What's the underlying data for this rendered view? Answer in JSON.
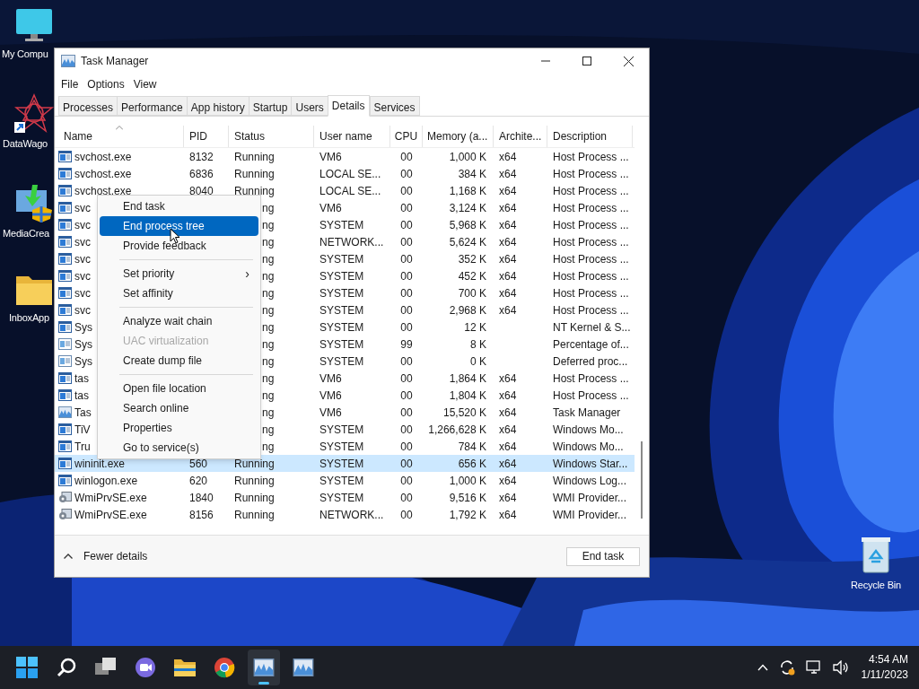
{
  "desktop_icons": [
    {
      "kind": "monitor",
      "label": "My Compu"
    },
    {
      "kind": "star",
      "label": "DataWago"
    },
    {
      "kind": "installer",
      "label": "MediaCrea"
    },
    {
      "kind": "folder",
      "label": "InboxApp"
    },
    {
      "kind": "bin",
      "label": "Recycle Bin"
    }
  ],
  "window": {
    "title": "Task Manager"
  },
  "menu_bar": [
    "File",
    "Options",
    "View"
  ],
  "tabs": [
    {
      "label": "Processes",
      "selected": false
    },
    {
      "label": "Performance",
      "selected": false
    },
    {
      "label": "App history",
      "selected": false
    },
    {
      "label": "Startup",
      "selected": false
    },
    {
      "label": "Users",
      "selected": false
    },
    {
      "label": "Details",
      "selected": true
    },
    {
      "label": "Services",
      "selected": false
    }
  ],
  "table": {
    "columns": [
      "Name",
      "PID",
      "Status",
      "User name",
      "CPU",
      "Memory (a...",
      "Archite...",
      "Description"
    ],
    "rows": [
      {
        "kind": "app",
        "name": "svchost.exe",
        "pid": "8132",
        "status": "Running",
        "user": "VM6",
        "cpu": "00",
        "memory": "1,000 K",
        "arch": "x64",
        "description": "Host Process ...",
        "selected": false
      },
      {
        "kind": "app",
        "name": "svchost.exe",
        "pid": "6836",
        "status": "Running",
        "user": "LOCAL SE...",
        "cpu": "00",
        "memory": "384 K",
        "arch": "x64",
        "description": "Host Process ...",
        "selected": false
      },
      {
        "kind": "app",
        "name": "svchost.exe",
        "pid": "8040",
        "status": "Running",
        "user": "LOCAL SE...",
        "cpu": "00",
        "memory": "1,168 K",
        "arch": "x64",
        "description": "Host Process ...",
        "selected": false
      },
      {
        "kind": "app",
        "name": "svc",
        "status": "ng",
        "user": "VM6",
        "cpu": "00",
        "memory": "3,124 K",
        "arch": "x64",
        "description": "Host Process ...",
        "selected": false
      },
      {
        "kind": "app",
        "name": "svc",
        "status": "ng",
        "user": "SYSTEM",
        "cpu": "00",
        "memory": "5,968 K",
        "arch": "x64",
        "description": "Host Process ...",
        "selected": false
      },
      {
        "kind": "app",
        "name": "svc",
        "status": "ng",
        "user": "NETWORK...",
        "cpu": "00",
        "memory": "5,624 K",
        "arch": "x64",
        "description": "Host Process ...",
        "selected": false
      },
      {
        "kind": "app",
        "name": "svc",
        "status": "ng",
        "user": "SYSTEM",
        "cpu": "00",
        "memory": "352 K",
        "arch": "x64",
        "description": "Host Process ...",
        "selected": false
      },
      {
        "kind": "app",
        "name": "svc",
        "status": "ng",
        "user": "SYSTEM",
        "cpu": "00",
        "memory": "452 K",
        "arch": "x64",
        "description": "Host Process ...",
        "selected": false
      },
      {
        "kind": "app",
        "name": "svc",
        "status": "ng",
        "user": "SYSTEM",
        "cpu": "00",
        "memory": "700 K",
        "arch": "x64",
        "description": "Host Process ...",
        "selected": false
      },
      {
        "kind": "app",
        "name": "svc",
        "status": "ng",
        "user": "SYSTEM",
        "cpu": "00",
        "memory": "2,968 K",
        "arch": "x64",
        "description": "Host Process ...",
        "selected": false
      },
      {
        "kind": "app",
        "name": "Sys",
        "status": "ng",
        "user": "SYSTEM",
        "cpu": "00",
        "memory": "12 K",
        "description": "NT Kernel & S...",
        "selected": false
      },
      {
        "kind": "system",
        "name": "Sys",
        "status": "ng",
        "user": "SYSTEM",
        "cpu": "99",
        "memory": "8 K",
        "description": "Percentage of...",
        "selected": false
      },
      {
        "kind": "system",
        "name": "Sys",
        "status": "ng",
        "user": "SYSTEM",
        "cpu": "00",
        "memory": "0 K",
        "description": "Deferred proc...",
        "selected": false
      },
      {
        "kind": "app",
        "name": "tas",
        "status": "ng",
        "user": "VM6",
        "cpu": "00",
        "memory": "1,864 K",
        "arch": "x64",
        "description": "Host Process ...",
        "selected": false
      },
      {
        "kind": "app",
        "name": "tas",
        "status": "ng",
        "user": "VM6",
        "cpu": "00",
        "memory": "1,804 K",
        "arch": "x64",
        "description": "Host Process ...",
        "selected": false
      },
      {
        "kind": "chart",
        "name": "Tas",
        "status": "ng",
        "user": "VM6",
        "cpu": "00",
        "memory": "15,520 K",
        "arch": "x64",
        "description": "Task Manager",
        "selected": false
      },
      {
        "kind": "app",
        "name": "TiV",
        "status": "ng",
        "user": "SYSTEM",
        "cpu": "00",
        "memory": "1,266,628 K",
        "arch": "x64",
        "description": "Windows Mo...",
        "selected": false
      },
      {
        "kind": "app",
        "name": "Tru",
        "status": "ng",
        "user": "SYSTEM",
        "cpu": "00",
        "memory": "784 K",
        "arch": "x64",
        "description": "Windows Mo...",
        "selected": false
      },
      {
        "kind": "app",
        "name": "wininit.exe",
        "pid": "560",
        "status": "Running",
        "user": "SYSTEM",
        "cpu": "00",
        "memory": "656 K",
        "arch": "x64",
        "description": "Windows Star...",
        "selected": true
      },
      {
        "kind": "app",
        "name": "winlogon.exe",
        "pid": "620",
        "status": "Running",
        "user": "SYSTEM",
        "cpu": "00",
        "memory": "1,000 K",
        "arch": "x64",
        "description": "Windows Log...",
        "selected": false
      },
      {
        "kind": "gear",
        "name": "WmiPrvSE.exe",
        "pid": "1840",
        "status": "Running",
        "user": "SYSTEM",
        "cpu": "00",
        "memory": "9,516 K",
        "arch": "x64",
        "description": "WMI Provider...",
        "selected": false
      },
      {
        "kind": "gear",
        "name": "WmiPrvSE.exe",
        "pid": "8156",
        "status": "Running",
        "user": "NETWORK...",
        "cpu": "00",
        "memory": "1,792 K",
        "arch": "x64",
        "description": "WMI Provider...",
        "selected": false
      }
    ]
  },
  "footer": {
    "fewer_details": "Fewer details",
    "end_task": "End task"
  },
  "context_menu": [
    {
      "kind": "item",
      "label": "End task",
      "selected": false,
      "disabled": false
    },
    {
      "kind": "item",
      "label": "End process tree",
      "selected": true,
      "disabled": false
    },
    {
      "kind": "item",
      "label": "Provide feedback",
      "selected": false,
      "disabled": false
    },
    {
      "kind": "separator"
    },
    {
      "kind": "item",
      "label": "Set priority",
      "selected": false,
      "disabled": false,
      "submenu": "›"
    },
    {
      "kind": "item",
      "label": "Set affinity",
      "selected": false,
      "disabled": false
    },
    {
      "kind": "separator"
    },
    {
      "kind": "item",
      "label": "Analyze wait chain",
      "selected": false,
      "disabled": false
    },
    {
      "kind": "item",
      "label": "UAC virtualization",
      "selected": false,
      "disabled": true
    },
    {
      "kind": "item",
      "label": "Create dump file",
      "selected": false,
      "disabled": false
    },
    {
      "kind": "separator"
    },
    {
      "kind": "item",
      "label": "Open file location",
      "selected": false,
      "disabled": false
    },
    {
      "kind": "item",
      "label": "Search online",
      "selected": false,
      "disabled": false
    },
    {
      "kind": "item",
      "label": "Properties",
      "selected": false,
      "disabled": false
    },
    {
      "kind": "item",
      "label": "Go to service(s)",
      "selected": false,
      "disabled": false
    }
  ],
  "taskbar": {
    "apps": [
      {
        "kind": "start",
        "active": false
      },
      {
        "kind": "search",
        "active": false
      },
      {
        "kind": "taskview",
        "active": false
      },
      {
        "kind": "chat",
        "active": false
      },
      {
        "kind": "folder",
        "active": false
      },
      {
        "kind": "browser",
        "active": false
      },
      {
        "kind": "chart",
        "active": true
      },
      {
        "kind": "chart",
        "active": false
      }
    ],
    "time": "4:54 AM",
    "date": "1/11/2023"
  }
}
